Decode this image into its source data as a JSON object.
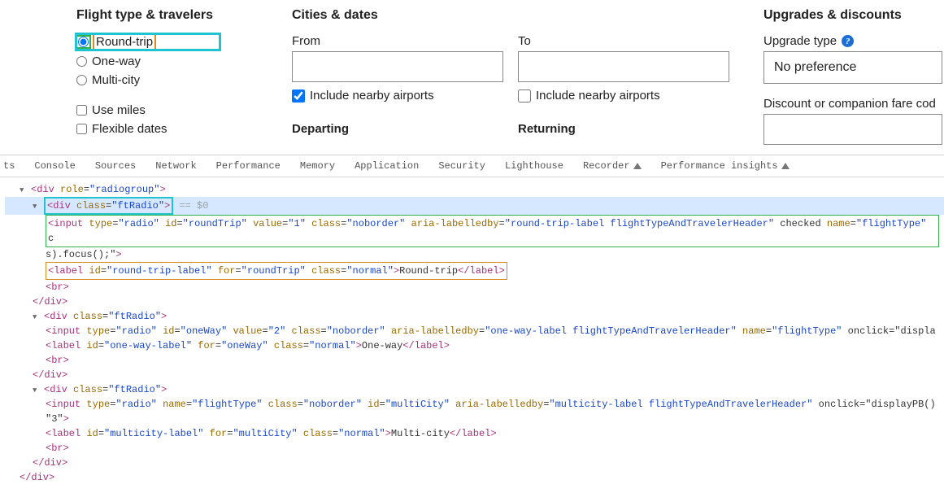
{
  "flightType": {
    "heading": "Flight type & travelers",
    "options": {
      "roundTrip": "Round-trip",
      "oneWay": "One-way",
      "multiCity": "Multi-city"
    },
    "checks": {
      "useMiles": "Use miles",
      "flexDates": "Flexible dates"
    }
  },
  "cities": {
    "heading": "Cities & dates",
    "from": "From",
    "to": "To",
    "nearby": "Include nearby airports",
    "departing": "Departing",
    "returning": "Returning"
  },
  "upgrades": {
    "heading": "Upgrades & discounts",
    "upgradeType": "Upgrade type",
    "noPreference": "No preference",
    "discountLabel": "Discount or companion fare cod"
  },
  "devtools": {
    "tabs": {
      "partial": "ts",
      "console": "Console",
      "sources": "Sources",
      "network": "Network",
      "performance": "Performance",
      "memory": "Memory",
      "application": "Application",
      "security": "Security",
      "lighthouse": "Lighthouse",
      "recorder": "Recorder",
      "perfInsights": "Performance insights"
    },
    "dom": {
      "l1": "<div role=\"radiogroup\">",
      "l2_open": "<div class=\"ftRadio\">",
      "l2_sel": " == $0",
      "l3a": "<input type=\"radio\" id=\"roundTrip\" value=\"1\" class=\"noborder\" aria-labelledby=\"round-trip-label flightTypeAndTravelerHeader\" checked name=\"flightType\" c",
      "l3b_frag": "s).focus();\">",
      "l4": "<label id=\"round-trip-label\" for=\"roundTrip\" class=\"normal\">Round-trip</label>",
      "l5": "<br>",
      "l6": "</div>",
      "l7": "<div class=\"ftRadio\">",
      "l8": "<input type=\"radio\" id=\"oneWay\" value=\"2\" class=\"noborder\" aria-labelledby=\"one-way-label flightTypeAndTravelerHeader\" name=\"flightType\" onclick=\"displa",
      "l9": "<label id=\"one-way-label\" for=\"oneWay\" class=\"normal\">One-way</label>",
      "l10": "<br>",
      "l11": "</div>",
      "l12": "<div class=\"ftRadio\">",
      "l13": "<input type=\"radio\" name=\"flightType\" class=\"noborder\" id=\"multiCity\" aria-labelledby=\"multicity-label flightTypeAndTravelerHeader\" onclick=\"displayPB()",
      "l13b": "\"3\">",
      "l14": "<label id=\"multicity-label\" for=\"multiCity\" class=\"normal\">Multi-city</label>",
      "l15": "<br>",
      "l16": "</div>",
      "l17": "</div>"
    }
  }
}
